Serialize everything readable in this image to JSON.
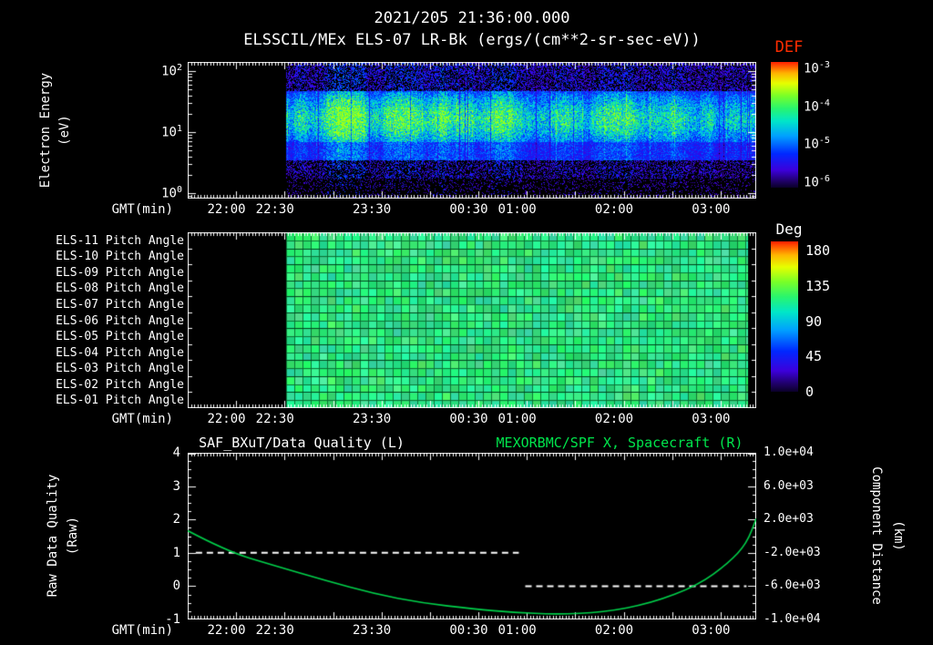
{
  "page_title": "2021/205 21:36:00.000",
  "main_title": "ELSSCIL/MEx ELS-07 LR-Bk (ergs/(cm**2-sr-sec-eV))",
  "axis": {
    "x_label": "GMT(min)",
    "x_start": "21:36:00",
    "x_span_min": 352,
    "x_minor_tick_min": 2,
    "x_major_tick_min": 30,
    "x_labeled_ticks": [
      {
        "label": "22:00",
        "offset_min": 24
      },
      {
        "label": "22:30",
        "offset_min": 54
      },
      {
        "label": "23:30",
        "offset_min": 114
      },
      {
        "label": "00:30",
        "offset_min": 174
      },
      {
        "label": "01:00",
        "offset_min": 204
      },
      {
        "label": "02:00",
        "offset_min": 264
      },
      {
        "label": "03:00",
        "offset_min": 324
      }
    ]
  },
  "chart_data": [
    {
      "type": "heatmap",
      "name": "electron-energy-spectrogram",
      "instrument": "ELSSCIL/MEx ELS-07 LR-Bk",
      "units": "ergs/(cm**2-sr-sec-eV)",
      "ylabel_line1": "Electron Energy",
      "ylabel_line2": "(eV)",
      "y_scale": "log",
      "y_tick_exponents": [
        2,
        1,
        0
      ],
      "y_range_ev": [
        0.8,
        140
      ],
      "data_start_min": 61,
      "data_end_min": 352,
      "colorbar": {
        "title": "DEF",
        "scale": "log",
        "tick_exponents": [
          -3,
          -4,
          -5,
          -6
        ]
      },
      "features": [
        {
          "energy_ev": [
            8,
            45
          ],
          "flux": "1e-4 to 3e-4",
          "appearance": "bright time-variable cyan-green band"
        },
        {
          "energy_ev": [
            45,
            140
          ],
          "flux": "~1e-5",
          "appearance": "blue speckle"
        },
        {
          "energy_ev": [
            0.8,
            5
          ],
          "flux": "<=1e-6",
          "appearance": "sparse purple-blue dots on black"
        },
        {
          "time": "23:10-23:25",
          "appearance": "bright green vertical enhancement"
        },
        {
          "time": "23:45-00:50",
          "appearance": "enhanced cyan band near 20-30 eV"
        }
      ]
    },
    {
      "type": "heatmap",
      "name": "pitch-angle-stack",
      "row_labels": [
        "ELS-11 Pitch Angle",
        "ELS-10 Pitch Angle",
        "ELS-09 Pitch Angle",
        "ELS-08 Pitch Angle",
        "ELS-07 Pitch Angle",
        "ELS-06 Pitch Angle",
        "ELS-05 Pitch Angle",
        "ELS-04 Pitch Angle",
        "ELS-03 Pitch Angle",
        "ELS-02 Pitch Angle",
        "ELS-01 Pitch Angle"
      ],
      "colorbar": {
        "title": "Deg",
        "ticks": [
          180,
          135,
          90,
          45,
          0
        ]
      },
      "data_start_min": 61,
      "data_end_min": 347,
      "dominant_value_deg": 90
    },
    {
      "type": "line",
      "name": "quality-and-spacecraft-x",
      "title_left": "SAF_BXuT/Data Quality (L)",
      "title_right": "MEXORBMC/SPF X, Spacecraft (R)",
      "ylabel_left_line1": "Raw Data Quality",
      "ylabel_left_line2": "(Raw)",
      "ylabel_right_line1": "Component Distance",
      "ylabel_right_line2": "(km)",
      "ylim_left": [
        -1,
        4
      ],
      "yticks_left": [
        4,
        3,
        2,
        1,
        0,
        -1
      ],
      "ylim_right": [
        -10000,
        10000
      ],
      "yticks_right": [
        "1.0e+04",
        "6.0e+03",
        "2.0e+03",
        "-2.0e+03",
        "-6.0e+03",
        "-1.0e+04"
      ],
      "series": [
        {
          "name": "SAF_BXuT/Data Quality",
          "axis": "left",
          "style": "dashed",
          "color": "#ffffff",
          "segments": [
            {
              "value": 1,
              "from_min": 5,
              "to_min": 205
            },
            {
              "value": 0,
              "from_min": 209,
              "to_min": 346
            }
          ]
        },
        {
          "name": "MEXORBMC/SPF X Spacecraft",
          "axis": "right",
          "style": "solid",
          "color": "#00d24b",
          "points_min_km": [
            [
              0,
              650
            ],
            [
              24,
              -1800
            ],
            [
              53,
              -3500
            ],
            [
              85,
              -5300
            ],
            [
              115,
              -6900
            ],
            [
              145,
              -8000
            ],
            [
              177,
              -8750
            ],
            [
              202,
              -9150
            ],
            [
              228,
              -9390
            ],
            [
              257,
              -9150
            ],
            [
              287,
              -8050
            ],
            [
              316,
              -5900
            ],
            [
              335,
              -3200
            ],
            [
              346,
              -900
            ],
            [
              352,
              2100
            ]
          ]
        }
      ]
    }
  ],
  "colors": {
    "background": "#000000",
    "text": "#ffffff",
    "def_title": "#ff2d00",
    "green_title": "#00e54c",
    "curve_green": "#00d24b"
  }
}
